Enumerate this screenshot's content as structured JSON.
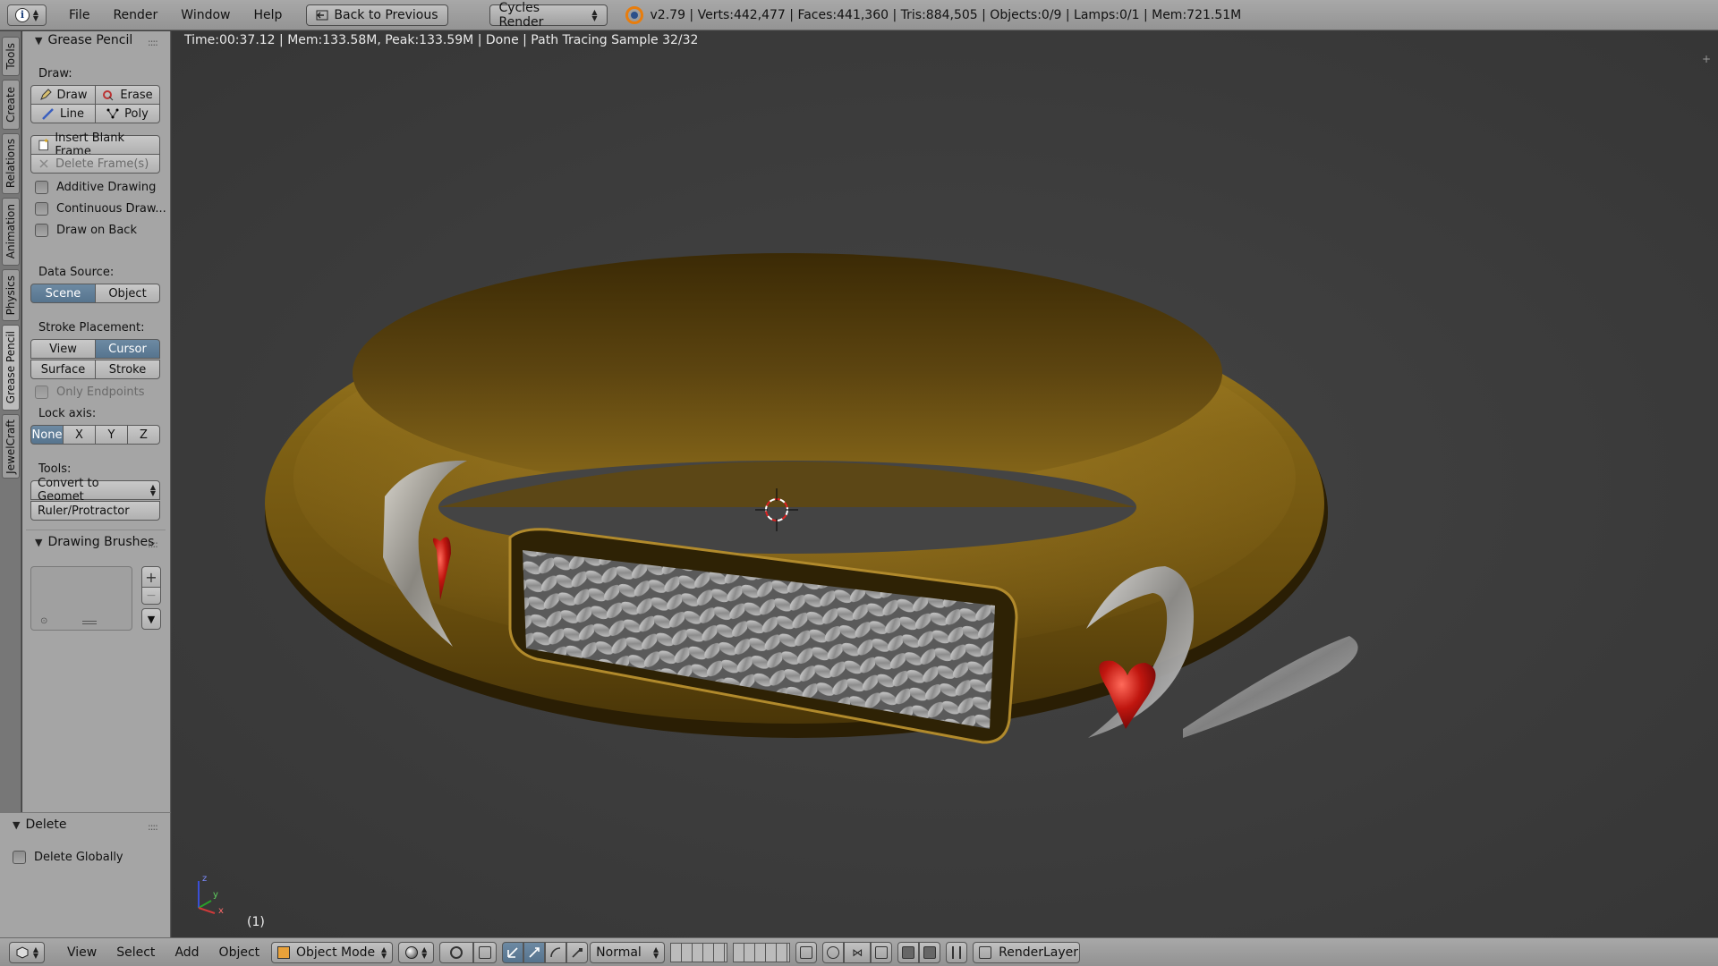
{
  "header": {
    "menus": [
      "File",
      "Render",
      "Window",
      "Help"
    ],
    "back_button": "Back to Previous",
    "render_engine": "Cycles Render",
    "stats": "v2.79 | Verts:442,477 | Faces:441,360 | Tris:884,505 | Objects:0/9 | Lamps:0/1 | Mem:721.51M"
  },
  "tabs": [
    "Tools",
    "Create",
    "Relations",
    "Animation",
    "Physics",
    "Grease Pencil",
    "JewelCraft"
  ],
  "grease_pencil": {
    "title": "Grease Pencil",
    "draw_label": "Draw:",
    "draw": "Draw",
    "erase": "Erase",
    "line": "Line",
    "poly": "Poly",
    "insert_blank_frame": "Insert Blank Frame",
    "delete_frames": "Delete Frame(s)",
    "additive_drawing": "Additive Drawing",
    "continuous_drawing": "Continuous Draw...",
    "draw_on_back": "Draw on Back",
    "data_source_label": "Data Source:",
    "data_source_scene": "Scene",
    "data_source_object": "Object",
    "stroke_placement_label": "Stroke Placement:",
    "placement_view": "View",
    "placement_cursor": "Cursor",
    "placement_surface": "Surface",
    "placement_stroke": "Stroke",
    "only_endpoints": "Only Endpoints",
    "lock_axis_label": "Lock axis:",
    "axis_none": "None",
    "axis_x": "X",
    "axis_y": "Y",
    "axis_z": "Z",
    "tools_label": "Tools:",
    "convert_to_geometry": "Convert to Geomet",
    "ruler_protractor": "Ruler/Protractor"
  },
  "drawing_brushes": {
    "title": "Drawing Brushes"
  },
  "operator_panel": {
    "title": "Delete",
    "delete_globally": "Delete Globally"
  },
  "viewport": {
    "render_status": "Time:00:37.12 | Mem:133.58M, Peak:133.59M | Done | Path Tracing Sample 32/32",
    "frame_indicator": "(1)",
    "axis_labels": {
      "z": "z",
      "y": "y",
      "x": "x"
    }
  },
  "bottom_bar": {
    "menus": [
      "View",
      "Select",
      "Add",
      "Object"
    ],
    "mode": "Object Mode",
    "pivot_orientation": "Normal",
    "render_layer": "RenderLayer"
  },
  "colors": {
    "selected_button": "#5f7d97",
    "panel_bg": "#a5a5a5",
    "viewport_bg": "#3d3d3d",
    "gold": "#8a6a1a",
    "ruby": "#b51a1a"
  }
}
